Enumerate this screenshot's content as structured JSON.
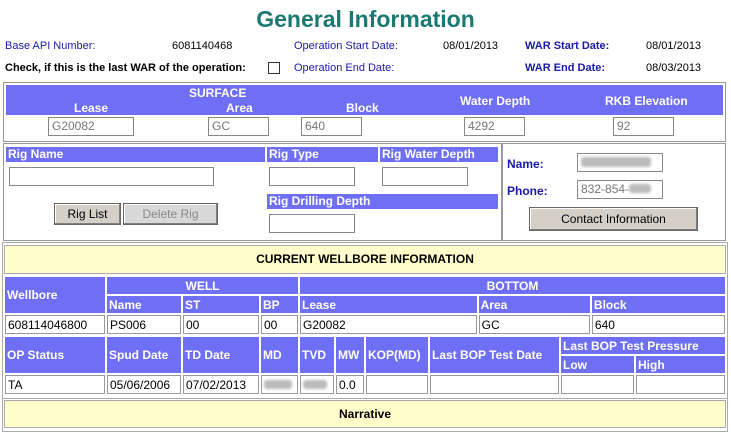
{
  "page_title": "General Information",
  "header": {
    "base_api_label": "Base API Number:",
    "base_api_value": "6081140468",
    "op_start_label": "Operation Start Date:",
    "op_start_value": "08/01/2013",
    "war_start_label": "WAR Start Date:",
    "war_start_value": "08/01/2013",
    "last_war_label": "Check, if this is the last WAR of the operation:",
    "op_end_label": "Operation End Date:",
    "war_end_label": "WAR End Date:",
    "war_end_value": "08/03/2013"
  },
  "surface": {
    "label": "SURFACE",
    "lease_label": "Lease",
    "lease_value": "G20082",
    "area_label": "Area",
    "area_value": "GC",
    "block_label": "Block",
    "block_value": "640",
    "water_depth_label": "Water Depth",
    "water_depth_value": "4292",
    "rkb_label": "RKB Elevation",
    "rkb_value": "92"
  },
  "rig": {
    "name_label": "Rig Name",
    "type_label": "Rig Type",
    "water_depth_label": "Rig Water Depth",
    "drilling_depth_label": "Rig Drilling Depth",
    "rig_list_button": "Rig List",
    "delete_rig_button": "Delete Rig"
  },
  "contact": {
    "name_label": "Name:",
    "phone_label": "Phone:",
    "phone_value": "832-854-",
    "contact_button": "Contact Information"
  },
  "wellbore": {
    "section_title": "CURRENT WELLBORE INFORMATION",
    "wellbore_label": "Wellbore",
    "well_label": "WELL",
    "bottom_label": "BOTTOM",
    "name_label": "Name",
    "st_label": "ST",
    "bp_label": "BP",
    "lease_label": "Lease",
    "area_label": "Area",
    "block_label": "Block",
    "wellbore_value": "608114046800",
    "name_value": "PS006",
    "st_value": "00",
    "bp_value": "00",
    "lease_value": "G20082",
    "area_value": "GC",
    "block_value": "640",
    "op_status_label": "OP Status",
    "spud_label": "Spud Date",
    "td_label": "TD Date",
    "md_label": "MD",
    "tvd_label": "TVD",
    "mw_label": "MW",
    "kop_label": "KOP(MD)",
    "last_bop_label": "Last BOP Test Date",
    "last_bop_pressure_label": "Last BOP Test Pressure",
    "low_label": "Low",
    "high_label": "High",
    "op_status_value": "TA",
    "spud_value": "05/06/2006",
    "td_value": "07/02/2013",
    "mw_value": "0.0"
  },
  "narrative": {
    "title": "Narrative"
  }
}
